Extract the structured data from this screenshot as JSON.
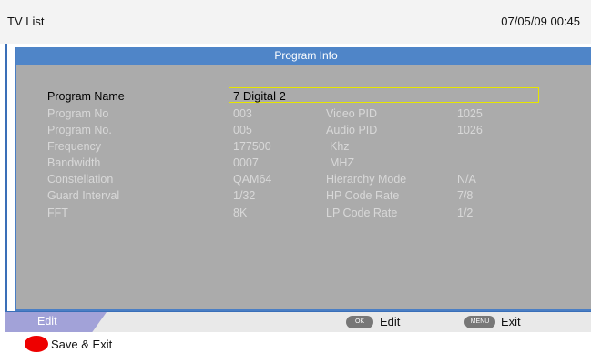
{
  "header": {
    "title": "TV List",
    "datetime": "07/05/09  00:45"
  },
  "panel": {
    "title": "Program Info"
  },
  "fields": {
    "program_name": {
      "label": "Program Name",
      "value": "7  Digital  2"
    },
    "program_no": {
      "label": "Program No",
      "value": "003"
    },
    "program_no2": {
      "label": "Program No.",
      "value": "005"
    },
    "frequency": {
      "label": "Frequency",
      "value": "177500",
      "unit": "Khz"
    },
    "bandwidth": {
      "label": "Bandwidth",
      "value": "0007",
      "unit": "MHZ"
    },
    "constellation": {
      "label": "Constellation",
      "value": "QAM64"
    },
    "guard_interval": {
      "label": "Guard Interval",
      "value": "1/32"
    },
    "fft": {
      "label": "FFT",
      "value": "8K"
    },
    "video_pid": {
      "label": "Video PID",
      "value": "1025"
    },
    "audio_pid": {
      "label": "Audio PID",
      "value": "1026"
    },
    "hierarchy_mode": {
      "label": "Hierarchy Mode",
      "value": "N/A"
    },
    "hp_code_rate": {
      "label": "HP Code Rate",
      "value": "7/8"
    },
    "lp_code_rate": {
      "label": "LP  Code Rate",
      "value": "1/2"
    }
  },
  "bottom_bar": {
    "mode": "Edit",
    "ok_key": "OK",
    "ok_label": "Edit",
    "menu_key": "MENU",
    "menu_label": "Exit"
  },
  "footer": {
    "save_label": "Save & Exit"
  },
  "colors": {
    "header_blue": "#4f85c8",
    "panel_gray": "#ababab",
    "selection_yellow": "#e6e600",
    "save_red": "#ee0000",
    "mode_tab": "#a2a2d8"
  }
}
